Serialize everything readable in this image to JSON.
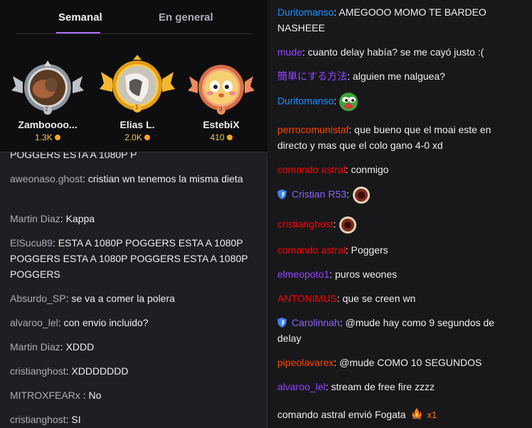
{
  "leaderboard": {
    "tabs": [
      {
        "label": "Semanal",
        "active": true
      },
      {
        "label": "En general",
        "active": false
      }
    ],
    "leaders": [
      {
        "name": "Zamboooo...",
        "points": "1.3K",
        "rank": "2",
        "ring": "silver"
      },
      {
        "name": "Elias L.",
        "points": "2.0K",
        "rank": "1",
        "ring": "gold"
      },
      {
        "name": "EstebiX",
        "points": "410",
        "rank": "3",
        "ring": "bronze"
      }
    ]
  },
  "left_chat": [
    {
      "user": "",
      "color": "#efeff1",
      "text": "POGGERS ESTA A 1080P P",
      "partial": true
    },
    {
      "user": "aweonaso.ghost",
      "color": "#adadb8",
      "text": "cristian wn tenemos la misma dieta"
    },
    {
      "user": "Martin Diaz",
      "color": "#adadb8",
      "text": "Kappa"
    },
    {
      "user": "ElSucu89",
      "color": "#adadb8",
      "text": "ESTA A 1080P POGGERS ESTA A 1080P POGGERS ESTA A 1080P POGGERS ESTA A 1080P POGGERS"
    },
    {
      "user": "Absurdo_SP",
      "color": "#adadb8",
      "text": "se va a comer la polera"
    },
    {
      "user": "alvaroo_lel",
      "color": "#adadb8",
      "text": "con envio incluido?"
    },
    {
      "user": "Martin Diaz",
      "color": "#adadb8",
      "text": "XDDD"
    },
    {
      "user": "cristianghost",
      "color": "#adadb8",
      "text": "XDDDDDDD"
    },
    {
      "user": "MITROXFEARx ",
      "color": "#adadb8",
      "text": "No"
    },
    {
      "user": "cristianghost",
      "color": "#adadb8",
      "text": "SI"
    }
  ],
  "right_chat": [
    {
      "user": "Duritomanso",
      "color": "#1e90ff",
      "text": "AMEGOOO MOMO TE BARDEO NASHEEE"
    },
    {
      "user": "mude",
      "color": "#9146ff",
      "text": "cuanto delay había? se me cayó justo :("
    },
    {
      "user": "簡単にする方法",
      "color": "#9146ff",
      "text": "alguien me nalguea?"
    },
    {
      "user": "Duritomanso",
      "color": "#1e90ff",
      "text": "",
      "emote": "pepe-emote"
    },
    {
      "user": "perrocomunistaf",
      "color": "#ff4500",
      "text": "que bueno que el moai este en directo y mas que el colo gano 4-0 xd"
    },
    {
      "user": "comando astral",
      "color": "#ff0000",
      "text": "conmigo"
    },
    {
      "user": "Cristian R53",
      "color": "#8a63f6",
      "text": "",
      "badge": "shield",
      "emote": "ring-emote"
    },
    {
      "user": "cristianghost",
      "color": "#ff0000",
      "text": "",
      "emote": "ring-emote"
    },
    {
      "user": "comando astral",
      "color": "#ff0000",
      "text": "Poggers"
    },
    {
      "user": "elmeopoto1",
      "color": "#9146ff",
      "text": "puros weones"
    },
    {
      "user": "ANTONIMUS",
      "color": "#ff0000",
      "text": "que se creen wn"
    },
    {
      "user": "Carolinnah",
      "color": "#8a63f6",
      "text": "@mude hay como 9 segundos de delay",
      "badge": "shield"
    },
    {
      "user": "pipeolavarex",
      "color": "#ff4500",
      "text": "@mude COMO 10 SEGUNDOS"
    },
    {
      "user": "alvaroo_lel",
      "color": "#9146ff",
      "text": "stream de free fire zzzz"
    }
  ],
  "gift": {
    "text": "comando astral envió Fogata",
    "count": "x1"
  }
}
